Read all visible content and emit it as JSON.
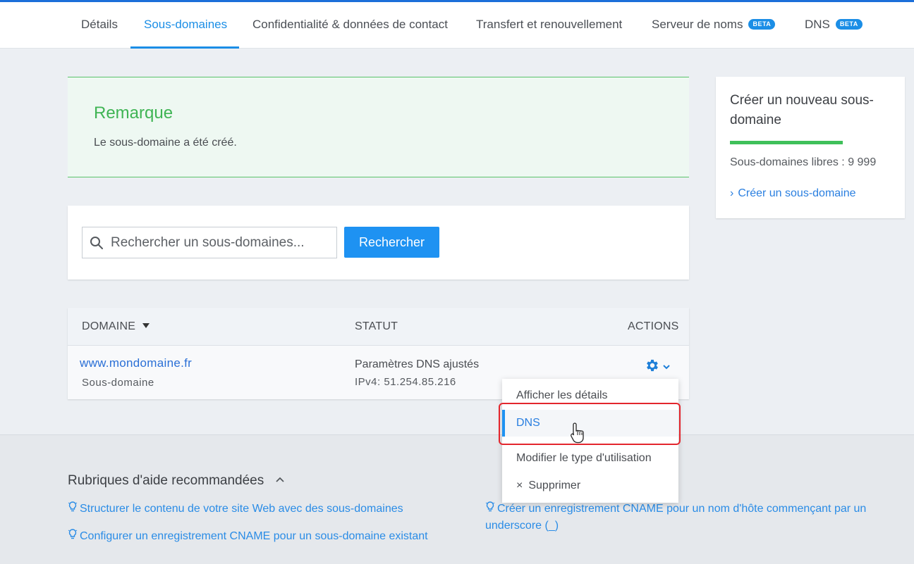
{
  "tabs": [
    {
      "label": "Détails"
    },
    {
      "label": "Sous-domaines",
      "active": true
    },
    {
      "label": "Confidentialité & données de contact"
    },
    {
      "label": "Transfert et renouvellement"
    },
    {
      "label": "Serveur de noms",
      "badge": "BETA"
    },
    {
      "label": "DNS",
      "badge": "BETA"
    }
  ],
  "notice": {
    "title": "Remarque",
    "text": "Le sous-domaine a été créé."
  },
  "search": {
    "placeholder": "Rechercher un sous-domaines...",
    "button_label": "Rechercher",
    "icon": "search-icon"
  },
  "table": {
    "columns": {
      "domain": "DOMAINE",
      "status": "STATUT",
      "actions": "ACTIONS"
    },
    "rows": [
      {
        "domain": "www.mondomaine.fr",
        "type": "Sous-domaine",
        "status": "Paramètres DNS ajustés",
        "ipv4": "IPv4: 51.254.85.216"
      }
    ]
  },
  "actions_menu": {
    "items": [
      {
        "label": "Afficher les détails"
      },
      {
        "label": "DNS",
        "selected": true
      },
      {
        "label": "Modifier le type d'utilisation"
      },
      {
        "label": "Supprimer",
        "prefix": "×"
      }
    ]
  },
  "sidebar": {
    "title": "Créer un nouveau sous-domaine",
    "free": "Sous-domaines libres : 9 999",
    "link": "Créer un sous-domaine"
  },
  "help": {
    "title": "Rubriques d'aide recommandées",
    "links": [
      "Structurer le contenu de votre site Web avec des sous-domaines",
      "Configurer un enregistrement CNAME pour un sous-domaine existant",
      "Créer un enregistrement CNAME pour un nom d'hôte commençant par un underscore (_)"
    ]
  },
  "colors": {
    "accent": "#1e92f2",
    "success": "#3fb454",
    "highlight": "#e3262d"
  }
}
